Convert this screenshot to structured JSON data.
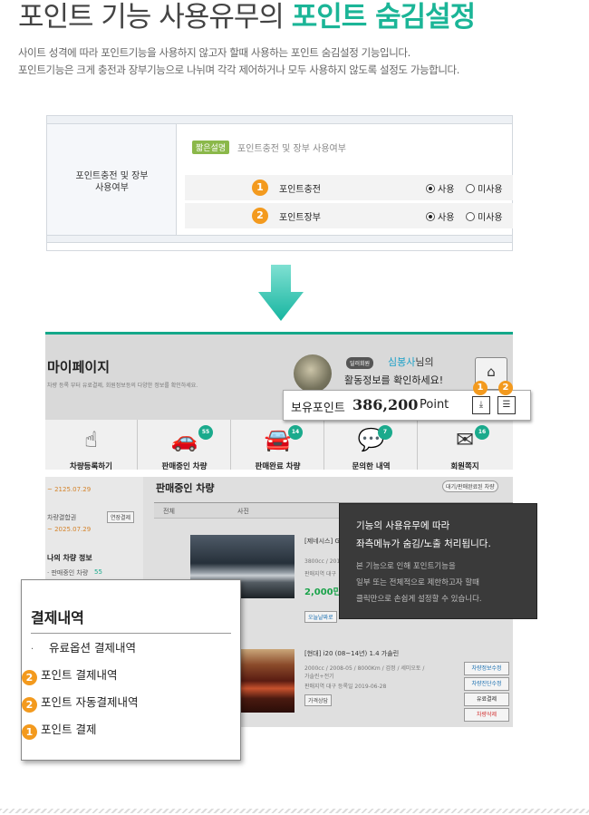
{
  "header": {
    "title_main": "포인트 기능 사용유무의 ",
    "title_accent": "포인트 숨김설정",
    "desc_line1": "사이트 성격에 따라 포인트기능을 사용하지 않고자 할때 사용하는 포인트 숨김설정 기능입니다.",
    "desc_line2": "포인트기능은 크게 충전과 장부기능으로 나뉘며 각각 제어하거나 모두 사용하지 않도록 설정도 가능합니다."
  },
  "settings_table": {
    "row_label": "포인트충전 및 장부\n사용여부",
    "tag": "짧은설명",
    "tag_text": "포인트충전 및 장부 사용여부",
    "rows": [
      {
        "num": "1",
        "name": "포인트충전",
        "opt_use": "사용",
        "opt_nouse": "미사용"
      },
      {
        "num": "2",
        "name": "포인트장부",
        "opt_use": "사용",
        "opt_nouse": "미사용"
      }
    ]
  },
  "mypage": {
    "title": "마이페이지",
    "subtitle": "차량 등록 부터 유료결제, 회원정보등의 다양한 정보를 확인하세요.",
    "grade": "딜러회원",
    "user_name": "심봉사",
    "user_suffix": "님의",
    "message": "활동정보를 확인하세요!",
    "icons": [
      {
        "label": "차량등록하기",
        "badge": "",
        "glyph": "☝"
      },
      {
        "label": "판매중인 차량",
        "badge": "55",
        "glyph": "🚗"
      },
      {
        "label": "판매완료 차량",
        "badge": "14",
        "glyph": "🚘"
      },
      {
        "label": "문의한 내역",
        "badge": "7",
        "glyph": "💬"
      },
      {
        "label": "회원쪽지",
        "badge": "16",
        "glyph": "✉"
      }
    ]
  },
  "point_box": {
    "label": "보유포인트",
    "value": "386,200",
    "unit": "Point",
    "btn1_num": "1",
    "btn2_num": "2"
  },
  "list_mock": {
    "left_date1": "~ 2125.07.29",
    "left_label2": "차량결합권",
    "left_btn2": "연장결제",
    "left_date2": "~ 2025.07.29",
    "left_section": "나의 차량 정보",
    "left_item": "· 판매중인 차량",
    "left_item_count": "55",
    "title": "판매중인 차량",
    "head_btn": "대기/판매완료된 차량",
    "col_all": "전체",
    "col_photo": "사진",
    "car1_title": "[제네시스] G80",
    "car1_spec": "3800cc / 2013",
    "car1_region": "판매지역  대구",
    "car1_price": "2,000만원",
    "car1_btn": "오늘날짜로",
    "car2_title": "[현대] i20 (08~14년) 1.4 가솔린",
    "car2_spec": "2000cc / 2008-05 / 8000Km / 검정 / 세미오토 /",
    "car2_spec2": "가솔린+전기",
    "car2_region": "판매지역  대구    등록일  2019-06-28",
    "car2_btn": "가격상담",
    "side_btns": [
      "차량정보수정",
      "차량진단수정",
      "유료결제",
      "차량삭제"
    ]
  },
  "tooltip": {
    "line1": "기능의 사용유무에 따라",
    "line2": "좌측메뉴가 숨김/노출 처리됩니다.",
    "line3": "본 기능으로 인해 포인트기능을",
    "line4": "일부 또는 전체적으로 제한하고자 할때",
    "line5": "클릭만으로 손쉽게 설정할 수 있습니다."
  },
  "payment": {
    "title": "결제내역",
    "items": [
      {
        "num": "",
        "label": "유료옵션 결제내역"
      },
      {
        "num": "2",
        "label": "포인트 결제내역"
      },
      {
        "num": "2",
        "label": "포인트 자동결제내역"
      },
      {
        "num": "1",
        "label": "포인트 결제"
      }
    ]
  },
  "colors": {
    "accent": "#1bb597",
    "badge_orange": "#f39a1e",
    "mypage_teal": "#15a88a"
  },
  "icons": [
    "radio-icon",
    "down-arrow-icon",
    "home-icon",
    "download-icon",
    "list-icon"
  ]
}
